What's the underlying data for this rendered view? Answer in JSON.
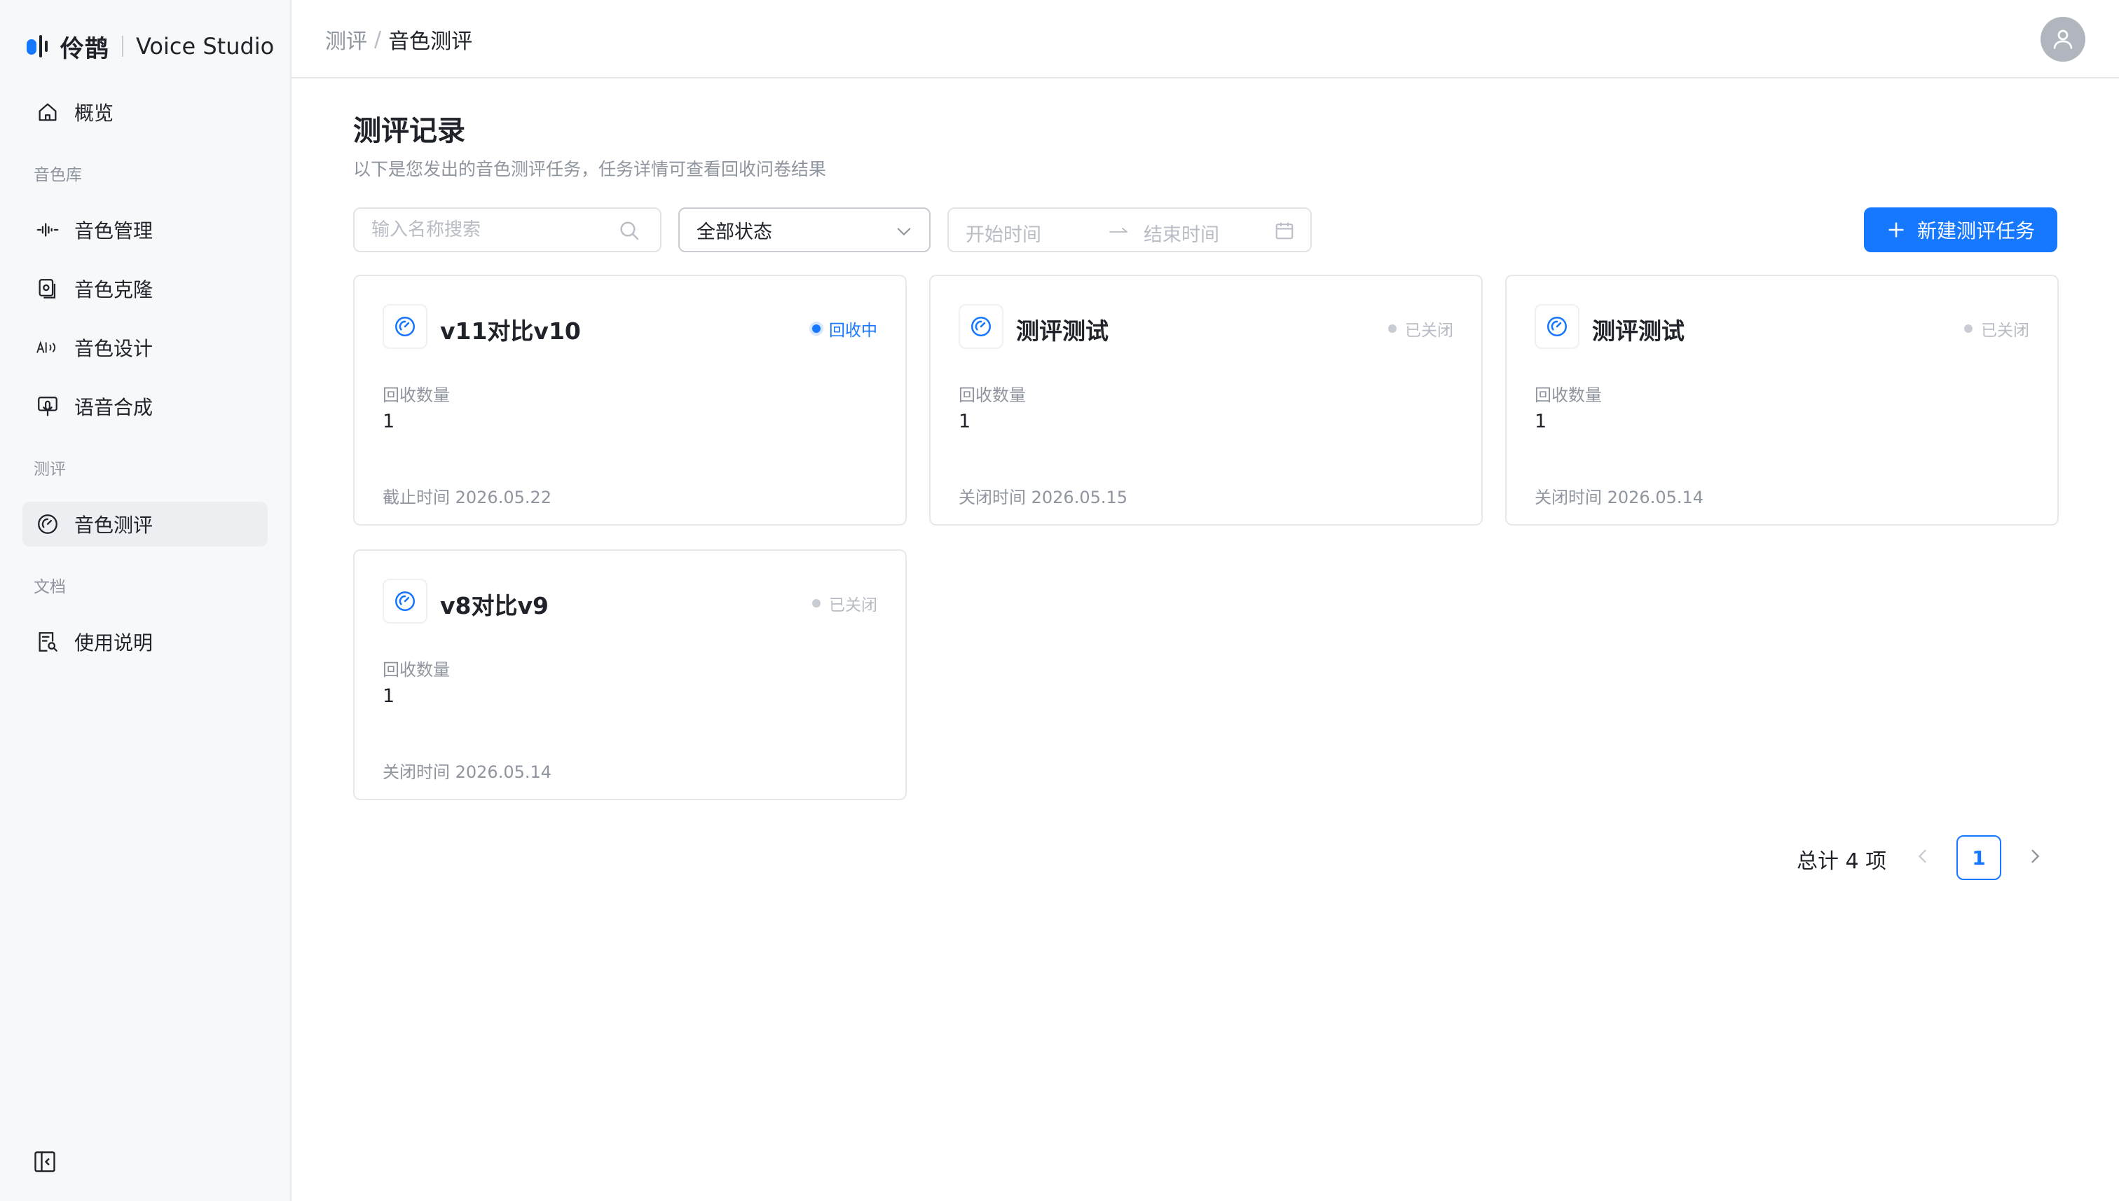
{
  "brand": {
    "cn": "伶鹊",
    "en": "Voice Studio"
  },
  "sidebar": {
    "items": [
      {
        "label": "概览",
        "icon": "home-icon"
      },
      {
        "group": "音色库"
      },
      {
        "label": "音色管理",
        "icon": "waveform-icon"
      },
      {
        "label": "音色克隆",
        "icon": "clone-icon"
      },
      {
        "label": "音色设计",
        "icon": "ai-voice-icon"
      },
      {
        "label": "语音合成",
        "icon": "synthesis-icon"
      },
      {
        "group": "测评"
      },
      {
        "label": "音色测评",
        "icon": "gauge-icon",
        "active": true
      },
      {
        "group": "文档"
      },
      {
        "label": "使用说明",
        "icon": "doc-search-icon"
      }
    ]
  },
  "header": {
    "breadcrumb_root": "测评",
    "breadcrumb_sep": "/",
    "breadcrumb_current": "音色测评"
  },
  "page": {
    "title": "测评记录",
    "description": "以下是您发出的音色测评任务，任务详情可查看回收问卷结果"
  },
  "filters": {
    "search_placeholder": "输入名称搜索",
    "status_value": "全部状态",
    "start_placeholder": "开始时间",
    "end_placeholder": "结束时间"
  },
  "new_button": "新建测评任务",
  "cards": [
    {
      "title": "v11对比v10",
      "status": "回收中",
      "status_type": "active",
      "count_label": "回收数量",
      "count": "1",
      "time": "截止时间 2026.05.22"
    },
    {
      "title": "测评测试",
      "status": "已关闭",
      "status_type": "closed",
      "count_label": "回收数量",
      "count": "1",
      "time": "关闭时间 2026.05.15"
    },
    {
      "title": "测评测试",
      "status": "已关闭",
      "status_type": "closed",
      "count_label": "回收数量",
      "count": "1",
      "time": "关闭时间 2026.05.14"
    },
    {
      "title": "v8对比v9",
      "status": "已关闭",
      "status_type": "closed",
      "count_label": "回收数量",
      "count": "1",
      "time": "关闭时间 2026.05.14"
    }
  ],
  "pagination": {
    "total": "总计 4 项",
    "current_page": "1"
  },
  "colors": {
    "primary": "#1677ff",
    "sidebar_bg": "#f7f8fa",
    "muted": "#8f959e"
  }
}
